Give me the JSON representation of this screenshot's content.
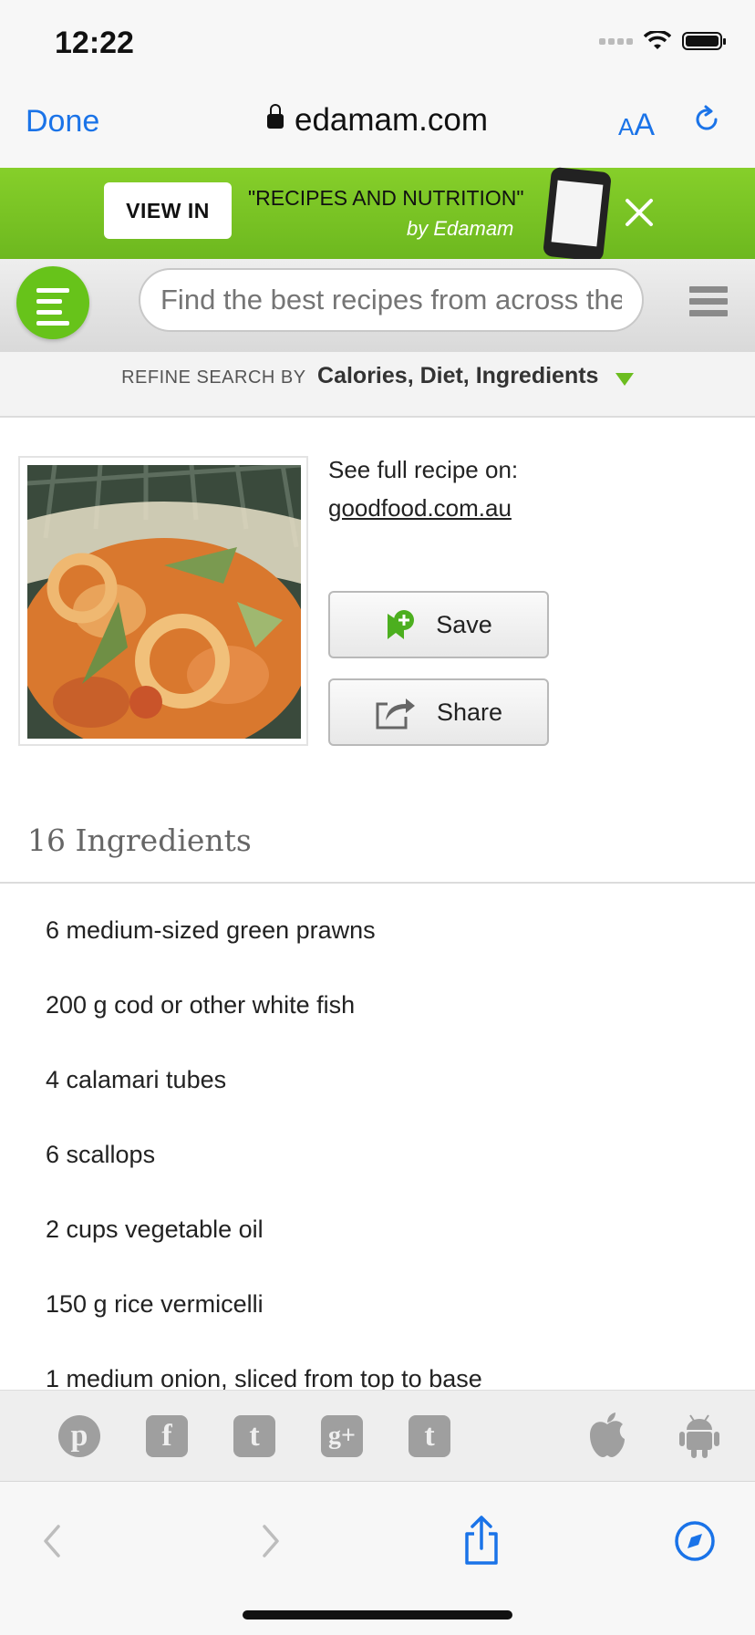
{
  "status_bar": {
    "time": "12:22"
  },
  "browser": {
    "done_label": "Done",
    "domain": "edamam.com",
    "text_size_small": "A",
    "text_size_big": "A"
  },
  "banner": {
    "view_in_label": "VIEW IN",
    "title": "\"RECIPES AND NUTRITION\"",
    "subtitle": "by Edamam"
  },
  "search": {
    "placeholder": "Find the best recipes from across the web"
  },
  "refine": {
    "label": "REFINE SEARCH BY",
    "options": "Calories, Diet, Ingredients"
  },
  "recipe": {
    "see_full_label": "See full recipe on:",
    "source": "goodfood.com.au",
    "save_label": "Save",
    "share_label": "Share"
  },
  "ingredients": {
    "title": "16 Ingredients",
    "items": [
      "6 medium-sized green prawns",
      "200 g cod or other white fish",
      "4 calamari tubes",
      "6 scallops",
      "2 cups vegetable oil",
      "150 g rice vermicelli",
      "1 medium onion, sliced from top to base"
    ]
  },
  "social": {
    "pinterest_glyph": "p",
    "facebook_glyph": "f",
    "twitter_glyph": "t",
    "googleplus_glyph": "g+",
    "tumblr_glyph": "t"
  },
  "colors": {
    "accent_blue": "#1a73e8",
    "brand_green": "#6db81f"
  }
}
